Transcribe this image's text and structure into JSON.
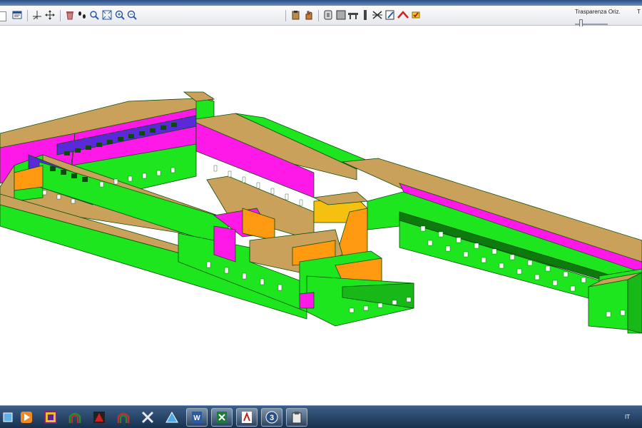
{
  "toolbar": {
    "slider_label": "Trasparenza Oriz.",
    "right_label": "T",
    "icons": [
      "dropdown-icon",
      "window-icon",
      "axis-icon",
      "pan-icon",
      "trash-icon",
      "footprints-icon",
      "zoom-extents-icon",
      "zoom-in-icon",
      "zoom-out-icon",
      "paste-icon",
      "hand-icon",
      "pillar-icon",
      "wall-icon",
      "beam-icon",
      "column-icon",
      "brace-icon",
      "diagonal-icon",
      "edit-icon",
      "roof-icon",
      "check-icon"
    ]
  },
  "model": {
    "colors": {
      "wall": "#1ee61e",
      "wall_dark": "#17b817",
      "magenta": "#ff19e8",
      "orange": "#ff9a10",
      "tan": "#c9a15a",
      "purple": "#5a2ad8",
      "yellow": "#f5c010",
      "window": "#ffffff",
      "edge": "#0a4d0a"
    }
  },
  "taskbar": {
    "lang": "IT",
    "icons": [
      "explorer-icon",
      "media-player-icon",
      "app-frame-icon",
      "arch-app-icon",
      "red-app-icon",
      "arch-app-2-icon",
      "tools-icon",
      "triangle-app-icon",
      "word-icon",
      "excel-icon",
      "acrobat-icon",
      "app-3-icon",
      "clipboard-icon"
    ]
  }
}
